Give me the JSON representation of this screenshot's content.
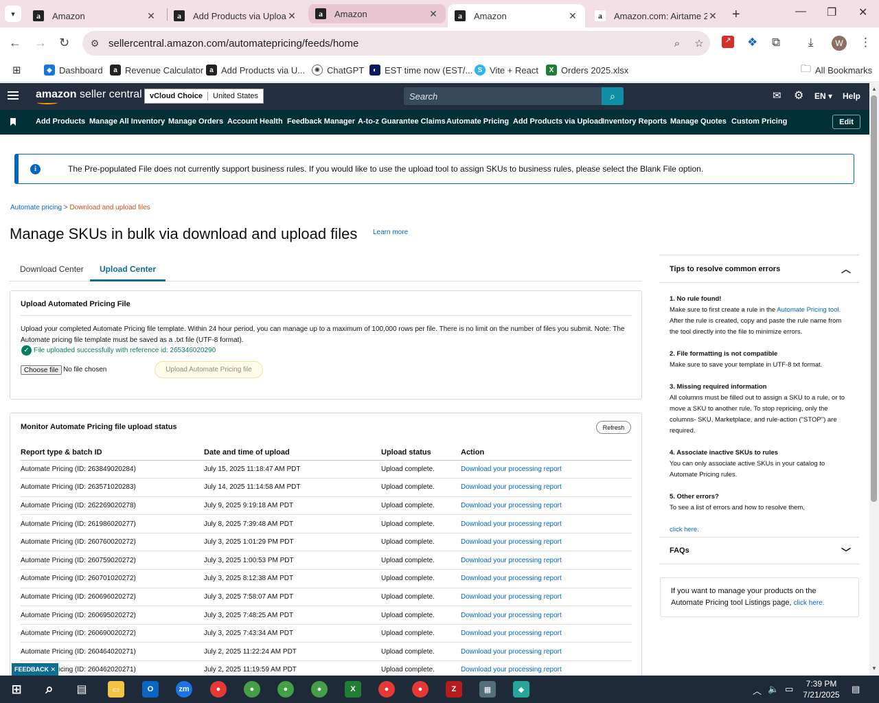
{
  "browser": {
    "tabs": [
      {
        "title": "Amazon"
      },
      {
        "title": "Add Products via Upload"
      },
      {
        "title": "Amazon"
      },
      {
        "title": "Amazon"
      },
      {
        "title": "Amazon.com: Airtame 2"
      }
    ],
    "url": "sellercentral.amazon.com/automatepricing/feeds/home",
    "bookmarks": [
      {
        "label": "Dashboard"
      },
      {
        "label": "Revenue Calculator"
      },
      {
        "label": "Add Products via U..."
      },
      {
        "label": "ChatGPT"
      },
      {
        "label": "EST time now (EST/..."
      },
      {
        "label": "Vite + React"
      },
      {
        "label": "Orders 2025.xlsx"
      }
    ],
    "all_bookmarks": "All Bookmarks",
    "profile_initial": "W"
  },
  "header": {
    "logo_a": "amazon",
    "logo_b": " seller central",
    "account": "vCloud Choice",
    "marketplace": "United States",
    "search_placeholder": "Search",
    "language": "EN",
    "help": "Help",
    "nav": [
      "Add Products",
      "Manage All Inventory",
      "Manage Orders",
      "Account Health",
      "Feedback Manager",
      "A-to-z Guarantee Claims",
      "Automate Pricing",
      "Add Products via Upload",
      "Inventory Reports",
      "Manage Quotes",
      "Custom Pricing"
    ],
    "edit": "Edit"
  },
  "alert": "The Pre-populated File does not currently support business rules. If you would like to use the upload tool to assign SKUs to business rules, please select the Blank File option.",
  "breadcrumb": {
    "parent": "Automate pricing",
    "sep": " > ",
    "current": "Download and upload files"
  },
  "page_title": "Manage SKUs in bulk via download and upload files",
  "learn_more": "Learn more",
  "tabs": [
    "Download Center",
    "Upload Center"
  ],
  "upload": {
    "title": "Upload Automated Pricing File",
    "desc": "Upload your completed Automate Pricing file template. Within 24 hour period, you can manage up to a maximum of 100,000 rows per file. There is no limit on the number of files you submit. Note: The Automate pricing file template must be saved as a .txt file (UTF-8 format).",
    "success": "File uploaded successfully with reference id: 265346020290",
    "choose": "Choose file",
    "nofile": "No file chosen",
    "button": "Upload Automate Pricing file"
  },
  "monitor": {
    "title": "Monitor Automate Pricing file upload status",
    "refresh": "Refresh",
    "columns": [
      "Report type & batch ID",
      "Date and time of upload",
      "Upload status",
      "Action"
    ],
    "rows": [
      [
        "Automate Pricing (ID: 263849020284)",
        "July 15, 2025 11:18:47 AM PDT",
        "Upload complete.",
        "Download your processing report"
      ],
      [
        "Automate Pricing (ID: 263571020283)",
        "July 14, 2025 11:14:58 AM PDT",
        "Upload complete.",
        "Download your processing report"
      ],
      [
        "Automate Pricing (ID: 262269020278)",
        "July 9, 2025 9:19:18 AM PDT",
        "Upload complete.",
        "Download your processing report"
      ],
      [
        "Automate Pricing (ID: 261986020277)",
        "July 8, 2025 7:39:48 AM PDT",
        "Upload complete.",
        "Download your processing report"
      ],
      [
        "Automate Pricing (ID: 260760020272)",
        "July 3, 2025 1:01:29 PM PDT",
        "Upload complete.",
        "Download your processing report"
      ],
      [
        "Automate Pricing (ID: 260759020272)",
        "July 3, 2025 1:00:53 PM PDT",
        "Upload complete.",
        "Download your processing report"
      ],
      [
        "Automate Pricing (ID: 260701020272)",
        "July 3, 2025 8:12:38 AM PDT",
        "Upload complete.",
        "Download your processing report"
      ],
      [
        "Automate Pricing (ID: 260696020272)",
        "July 3, 2025 7:58:07 AM PDT",
        "Upload complete.",
        "Download your processing report"
      ],
      [
        "Automate Pricing (ID: 260695020272)",
        "July 3, 2025 7:48:25 AM PDT",
        "Upload complete.",
        "Download your processing report"
      ],
      [
        "Automate Pricing (ID: 260690020272)",
        "July 3, 2025 7:43:34 AM PDT",
        "Upload complete.",
        "Download your processing report"
      ],
      [
        "Automate Pricing (ID: 260464020271)",
        "July 2, 2025 11:22:24 AM PDT",
        "Upload complete.",
        "Download your processing report"
      ],
      [
        "Automate Pricing (ID: 260462020271)",
        "July 2, 2025 11:19:59 AM PDT",
        "Upload complete.",
        "Download your processing report"
      ]
    ]
  },
  "feedback": "FEEDBACK",
  "tips": {
    "title": "Tips to resolve common errors",
    "items": [
      {
        "h": "1. No rule found!",
        "t1": "Make sure to first create a rule in the ",
        "link": "Automate Pricing tool.",
        "t2": "  After the rule is created, copy and paste the rule name from the tool directly into the file to minimize errors."
      },
      {
        "h": "2. File formatting is not compatible",
        "t1": "Make sure to save your template in UTF-8 txt format."
      },
      {
        "h": "3. Missing required information",
        "t1": "All columns must be filled out to assign a SKU to a rule, or to move a SKU to another rule. To stop repricing, only the columns- SKU, Marketplace, and rule-action (\"STOP\") are required."
      },
      {
        "h": "4. Associate inactive SKUs to rules",
        "t1": "You can only associate active SKUs in your catalog to Automate Pricing rules."
      },
      {
        "h": "5. Other errors?",
        "t1": "To see a list of errors and how to resolve them,",
        "link2": "click here."
      }
    ]
  },
  "faqs": "FAQs",
  "manage_box": {
    "text": "If you want to manage your products on the Automate Pricing tool Listings page, ",
    "link": "click here."
  },
  "taskbar": {
    "time": "7:39 PM",
    "date": "7/21/2025"
  }
}
